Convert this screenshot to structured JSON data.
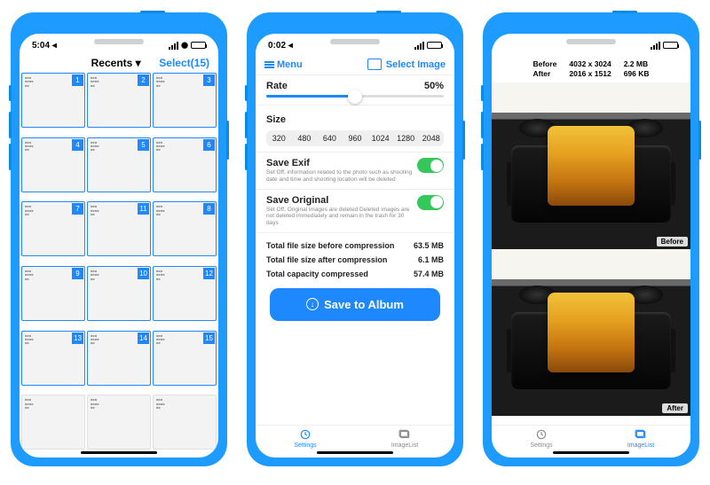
{
  "phone1": {
    "time": "5:04 ◂",
    "title": "Recents ▾",
    "select_label": "Select(15)",
    "selected_count": 15,
    "thumbs": [
      {
        "n": 1,
        "sel": true
      },
      {
        "n": 2,
        "sel": true
      },
      {
        "n": 3,
        "sel": true
      },
      {
        "n": 4,
        "sel": true
      },
      {
        "n": 5,
        "sel": true
      },
      {
        "n": 6,
        "sel": true
      },
      {
        "n": 7,
        "sel": true
      },
      {
        "n": 11,
        "sel": true
      },
      {
        "n": 8,
        "sel": true
      },
      {
        "n": 9,
        "sel": true
      },
      {
        "n": 10,
        "sel": true
      },
      {
        "n": 12,
        "sel": true
      },
      {
        "n": 13,
        "sel": true
      },
      {
        "n": 14,
        "sel": true
      },
      {
        "n": 15,
        "sel": true
      },
      {
        "n": 0,
        "sel": false
      },
      {
        "n": 0,
        "sel": false
      },
      {
        "n": 0,
        "sel": false
      }
    ]
  },
  "phone2": {
    "time": "0:02 ◂",
    "menu_label": "Menu",
    "select_image_label": "Select Image",
    "rate_label": "Rate",
    "rate_value": "50%",
    "size_label": "Size",
    "sizes": [
      "320",
      "480",
      "640",
      "960",
      "1024",
      "1280",
      "2048"
    ],
    "save_exif": {
      "label": "Save Exif",
      "desc": "Set Off, information related to the photo such as shooting date and time and shooting location will be deleted"
    },
    "save_original": {
      "label": "Save Original",
      "desc": "Set Off, Original images are deleted\nDeleted images are not deleted immediately and remain in the trash for 30 days"
    },
    "stats": {
      "before_label": "Total file size before compression",
      "before_value": "63.5 MB",
      "after_label": "Total file size after compression",
      "after_value": "6.1 MB",
      "capacity_label": "Total capacity compressed",
      "capacity_value": "57.4 MB"
    },
    "save_to_album": "Save to Album",
    "tabs": {
      "settings": "Settings",
      "imagelist": "ImageList"
    }
  },
  "phone3": {
    "info": {
      "before_label": "Before",
      "before_dim": "4032 x 3024",
      "before_size": "2.2 MB",
      "after_label": "After",
      "after_dim": "2016 x 1512",
      "after_size": "696 KB"
    },
    "tag_before": "Before",
    "tag_after": "After",
    "tabs": {
      "settings": "Settings",
      "imagelist": "ImageList"
    }
  }
}
